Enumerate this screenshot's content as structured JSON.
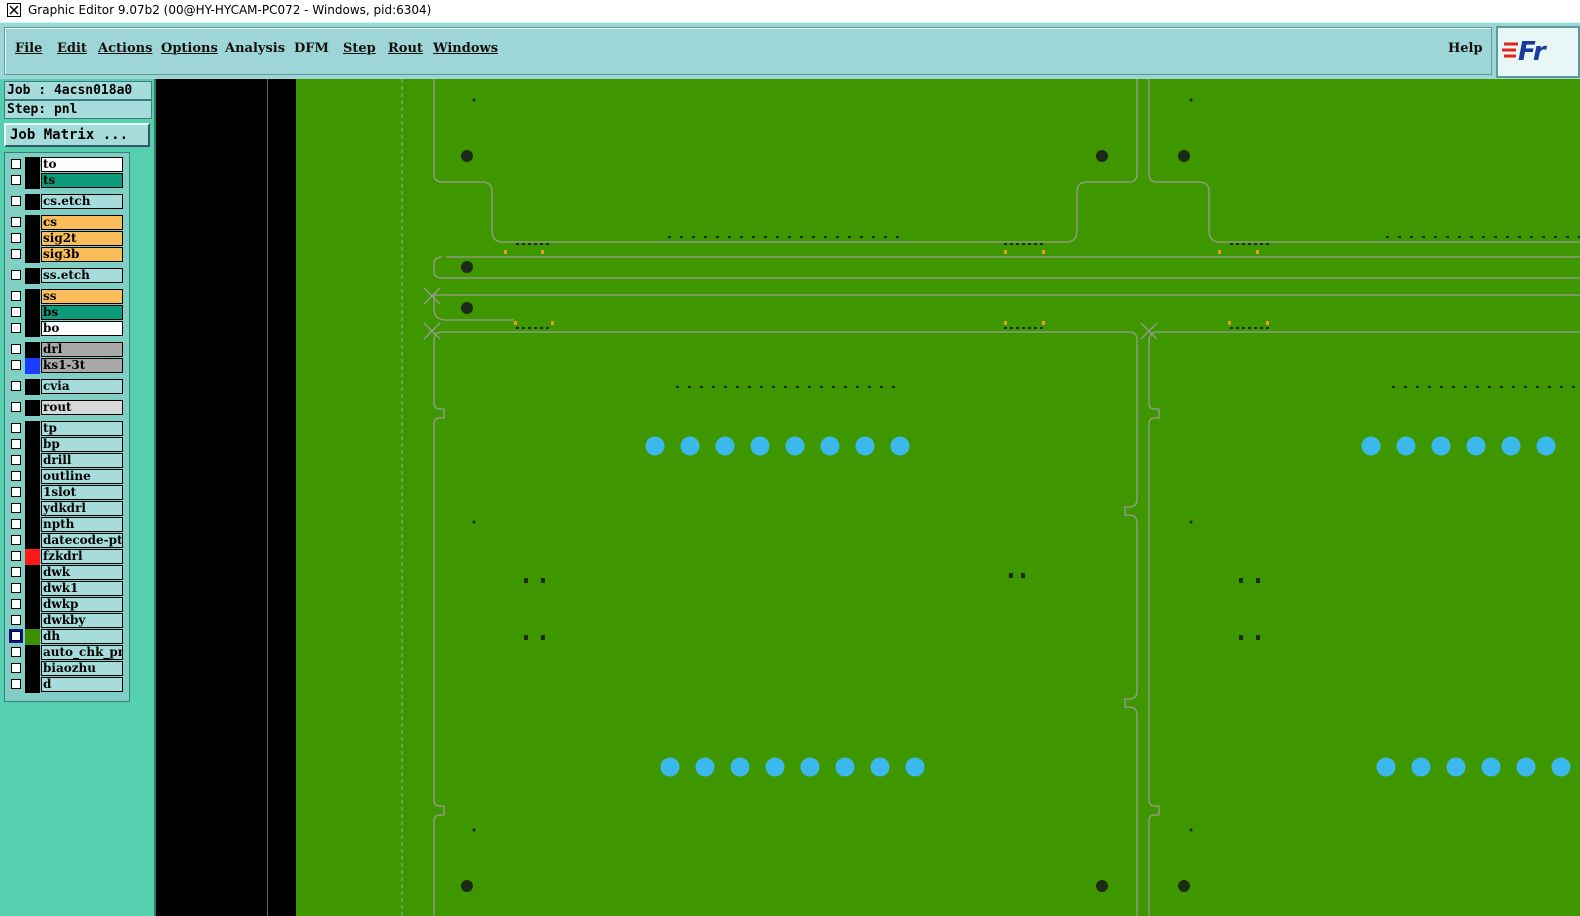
{
  "window": {
    "title": "Graphic Editor 9.07b2 (00@HY-HYCAM-PC072 - Windows, pid:6304)"
  },
  "menu": {
    "items": [
      {
        "label": "File",
        "name": "menu-file"
      },
      {
        "label": "Edit",
        "name": "menu-edit"
      },
      {
        "label": "Actions",
        "name": "menu-actions"
      },
      {
        "label": "Options",
        "name": "menu-options"
      },
      {
        "label": "Analysis",
        "name": "menu-analysis"
      },
      {
        "label": "DFM",
        "name": "menu-dfm"
      },
      {
        "label": "Step",
        "name": "menu-step"
      },
      {
        "label": "Rout",
        "name": "menu-rout"
      },
      {
        "label": "Windows",
        "name": "menu-windows"
      }
    ],
    "help": "Help",
    "logo": "Fr"
  },
  "job": {
    "job_line": "Job : 4acsn018a0",
    "step_line": "Step: pnl",
    "matrix_button": "Job Matrix ..."
  },
  "layers": [
    {
      "name": "to",
      "color": "#ffffff",
      "swatch": "#000000"
    },
    {
      "name": "ts",
      "color": "#0d9b7c",
      "swatch": "#000000"
    },
    {
      "name": "cs.etch",
      "color": "#a6dcdc",
      "swatch": "#000000"
    },
    {
      "name": "cs",
      "color": "#fbbd5a",
      "swatch": "#000000"
    },
    {
      "name": "sig2t",
      "color": "#fbbd5a",
      "swatch": "#000000"
    },
    {
      "name": "sig3b",
      "color": "#fbbd5a",
      "swatch": "#000000"
    },
    {
      "name": "ss.etch",
      "color": "#a6dcdc",
      "swatch": "#000000"
    },
    {
      "name": "ss",
      "color": "#fbbd5a",
      "swatch": "#000000"
    },
    {
      "name": "bs",
      "color": "#0d9b7c",
      "swatch": "#000000"
    },
    {
      "name": "bo",
      "color": "#ffffff",
      "swatch": "#000000"
    },
    {
      "name": "drl",
      "color": "#a9a9a9",
      "swatch": "#000000"
    },
    {
      "name": "ks1-3t",
      "color": "#a9a9a9",
      "swatch": "#1d3cff"
    },
    {
      "name": "cvia",
      "color": "#a6dcdc",
      "swatch": "#000000"
    },
    {
      "name": "rout",
      "color": "#d8d8d8",
      "swatch": "#000000"
    },
    {
      "name": "tp",
      "color": "#a6dcdc",
      "swatch": "#000000"
    },
    {
      "name": "bp",
      "color": "#a6dcdc",
      "swatch": "#000000"
    },
    {
      "name": "drill",
      "color": "#a6dcdc",
      "swatch": "#000000"
    },
    {
      "name": "outline",
      "color": "#a6dcdc",
      "swatch": "#000000"
    },
    {
      "name": "1slot",
      "color": "#a6dcdc",
      "swatch": "#000000"
    },
    {
      "name": "ydkdrl",
      "color": "#a6dcdc",
      "swatch": "#000000"
    },
    {
      "name": "npth",
      "color": "#a6dcdc",
      "swatch": "#000000"
    },
    {
      "name": "datecode-ptc",
      "color": "#a6dcdc",
      "swatch": "#000000"
    },
    {
      "name": "fzkdrl",
      "color": "#a6dcdc",
      "swatch": "#ff1a1a"
    },
    {
      "name": "dwk",
      "color": "#a6dcdc",
      "swatch": "#000000"
    },
    {
      "name": "dwk1",
      "color": "#a6dcdc",
      "swatch": "#000000"
    },
    {
      "name": "dwkp",
      "color": "#a6dcdc",
      "swatch": "#000000"
    },
    {
      "name": "dwkby",
      "color": "#a6dcdc",
      "swatch": "#000000"
    },
    {
      "name": "dh",
      "color": "#a6dcdc",
      "swatch": "#3f8f00",
      "selected": true
    },
    {
      "name": "auto_chk_pnl",
      "color": "#a6dcdc",
      "swatch": "#000000"
    },
    {
      "name": "biaozhu",
      "color": "#a6dcdc",
      "swatch": "#000000"
    },
    {
      "name": "d",
      "color": "#a6dcdc",
      "swatch": "#000000"
    }
  ],
  "colors": {
    "board": "#3f9700",
    "pad": "#3bb9ec",
    "outline": "#9a9a9a",
    "hole": "#1b2b14"
  }
}
